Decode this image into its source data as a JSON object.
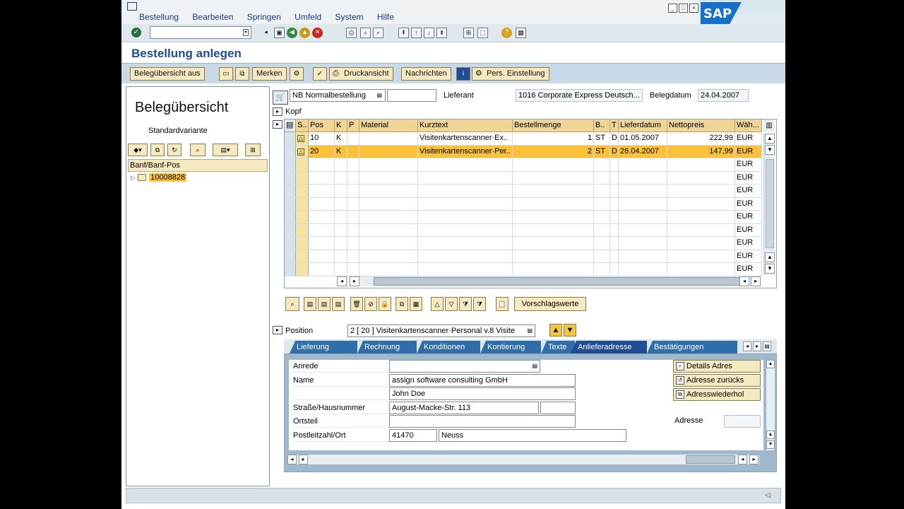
{
  "menu": [
    "Bestellung",
    "Bearbeiten",
    "Springen",
    "Umfeld",
    "System",
    "Hilfe"
  ],
  "brand": "SAP",
  "title": "Bestellung anlegen",
  "app_toolbar": {
    "belegubersicht": "Belegübersicht aus",
    "merken": "Merken",
    "druckansicht": "Druckansicht",
    "nachrichten": "Nachrichten",
    "pers_einstellung": "Pers. Einstellung"
  },
  "left_panel": {
    "title": "Belegübersicht",
    "variant": "Standardvariante",
    "column": "Banf/Banf-Pos",
    "node": "10008828"
  },
  "header": {
    "order_type": "NB Normalbestellung",
    "lieferant_label": "Lieferant",
    "lieferant_value": "1016 Corporate Express Deutsch...",
    "belegdatum_label": "Belegdatum",
    "belegdatum_value": "24.04.2007",
    "kopf_label": "Kopf"
  },
  "grid": {
    "columns": [
      "S..",
      "Pos",
      "K",
      "P",
      "Material",
      "Kurztext",
      "Bestellmenge",
      "B..",
      "T",
      "Lieferdatum",
      "Nettopreis",
      "Wäh..."
    ],
    "rows": [
      {
        "pos": "10",
        "k": "K",
        "p": "",
        "material": "",
        "kurztext": "Visitenkartenscanner·Ex..",
        "menge": "1",
        "b": "ST",
        "t": "D",
        "lieferdatum": "01.05.2007",
        "preis": "222,99",
        "wahrung": "EUR"
      },
      {
        "pos": "20",
        "k": "K",
        "p": "",
        "material": "",
        "kurztext": "Visitenkartenscanner·Per..",
        "menge": "2",
        "b": "ST",
        "t": "D",
        "lieferdatum": "26.04.2007",
        "preis": "147,99",
        "wahrung": "EUR"
      },
      {
        "pos": "",
        "k": "",
        "p": "",
        "material": "",
        "kurztext": "",
        "menge": "",
        "b": "",
        "t": "",
        "lieferdatum": "",
        "preis": "",
        "wahrung": "EUR"
      },
      {
        "pos": "",
        "k": "",
        "p": "",
        "material": "",
        "kurztext": "",
        "menge": "",
        "b": "",
        "t": "",
        "lieferdatum": "",
        "preis": "",
        "wahrung": "EUR"
      },
      {
        "pos": "",
        "k": "",
        "p": "",
        "material": "",
        "kurztext": "",
        "menge": "",
        "b": "",
        "t": "",
        "lieferdatum": "",
        "preis": "",
        "wahrung": "EUR"
      },
      {
        "pos": "",
        "k": "",
        "p": "",
        "material": "",
        "kurztext": "",
        "menge": "",
        "b": "",
        "t": "",
        "lieferdatum": "",
        "preis": "",
        "wahrung": "EUR"
      },
      {
        "pos": "",
        "k": "",
        "p": "",
        "material": "",
        "kurztext": "",
        "menge": "",
        "b": "",
        "t": "",
        "lieferdatum": "",
        "preis": "",
        "wahrung": "EUR"
      },
      {
        "pos": "",
        "k": "",
        "p": "",
        "material": "",
        "kurztext": "",
        "menge": "",
        "b": "",
        "t": "",
        "lieferdatum": "",
        "preis": "",
        "wahrung": "EUR"
      },
      {
        "pos": "",
        "k": "",
        "p": "",
        "material": "",
        "kurztext": "",
        "menge": "",
        "b": "",
        "t": "",
        "lieferdatum": "",
        "preis": "",
        "wahrung": "EUR"
      },
      {
        "pos": "",
        "k": "",
        "p": "",
        "material": "",
        "kurztext": "",
        "menge": "",
        "b": "",
        "t": "",
        "lieferdatum": "",
        "preis": "",
        "wahrung": "EUR"
      },
      {
        "pos": "",
        "k": "",
        "p": "",
        "material": "",
        "kurztext": "",
        "menge": "",
        "b": "",
        "t": "",
        "lieferdatum": "",
        "preis": "",
        "wahrung": "EUR"
      }
    ]
  },
  "vorschlagswerte": "Vorschlagswerte",
  "position": {
    "label": "Position",
    "value": "2 [ 20 ] Visitenkartenscanner·Personal v.8 Visite"
  },
  "tabs": [
    "Lieferung",
    "Rechnung",
    "Konditionen",
    "Kontierung",
    "Texte",
    "Anlieferadresse",
    "Bestätigungen"
  ],
  "address": {
    "anrede_label": "Anrede",
    "name_label": "Name",
    "name1": "assign software consulting GmbH",
    "name2": "John Doe",
    "strasse_label": "Straße/Hausnummer",
    "strasse": "August-Macke-Str. 113",
    "ortsteil_label": "Ortsteil",
    "plz_label": "Postleitzahl/Ort",
    "plz": "41470",
    "ort": "Neuss",
    "adresse_label": "Adresse",
    "details_btn": "Details Adres",
    "zurueck_btn": "Adresse zurücks",
    "wiederhol_btn": "Adresswiederhol"
  }
}
